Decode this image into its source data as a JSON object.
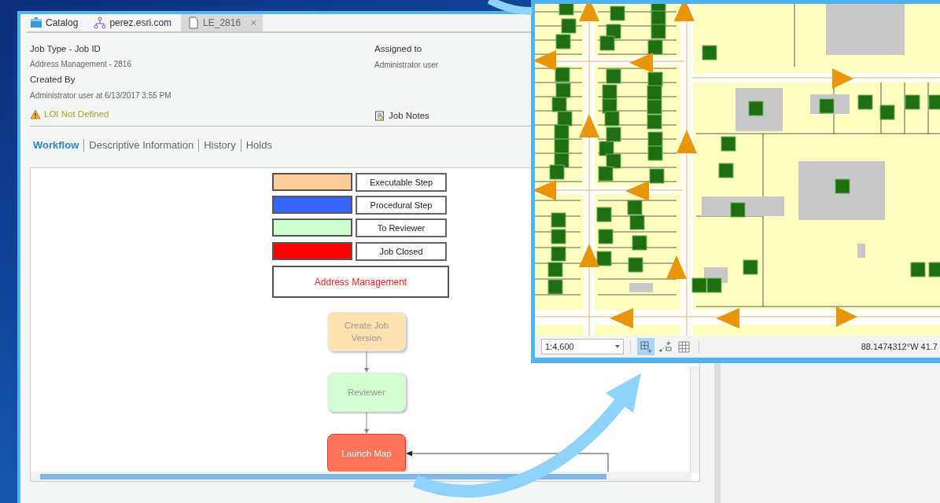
{
  "tabs": [
    {
      "kind": "catalog",
      "label": "Catalog",
      "selected": false,
      "closable": false
    },
    {
      "kind": "portal",
      "label": "perez.esri.com",
      "selected": false,
      "closable": false
    },
    {
      "kind": "document",
      "label": "LE_2816",
      "selected": true,
      "closable": true
    }
  ],
  "close_glyph": "×",
  "job": {
    "fields": [
      {
        "label": "Job Type - Job ID",
        "value": "Address Management - 2816"
      },
      {
        "label": "Created By",
        "value": "Administrator user at 6/13/2017 3:55 PM"
      }
    ],
    "assigned": {
      "label": "Assigned to",
      "value": "Administrator user"
    },
    "warning": "LOI Not Defined",
    "notes": "Job Notes"
  },
  "views": [
    {
      "label": "Workflow",
      "selected": true
    },
    {
      "label": "Descriptive Information",
      "selected": false
    },
    {
      "label": "History",
      "selected": false
    },
    {
      "label": "Holds",
      "selected": false
    }
  ],
  "legend": [
    {
      "label": "Executable Step",
      "color": "#ffcc99"
    },
    {
      "label": "Procedural Step",
      "color": "#3366ff"
    },
    {
      "label": "To Reviewer",
      "color": "#ccffcc"
    },
    {
      "label": "Job Closed",
      "color": "#ff0000"
    }
  ],
  "diagram_title": "Address Management",
  "steps": [
    {
      "label": "Create Job Version",
      "color": "#fde2b0",
      "active": false
    },
    {
      "label": "Reviewer",
      "color": "#d2fbd2",
      "active": false
    },
    {
      "label": "Launch Map",
      "color": "#ff735a",
      "active": true
    }
  ],
  "map": {
    "scale": "1:4,600",
    "tools": [
      {
        "kind": "grid-add",
        "selected": true
      },
      {
        "kind": "snapping",
        "selected": false
      },
      {
        "kind": "grid",
        "selected": false
      }
    ],
    "coordinates": "88.1474312°W 41.7"
  }
}
